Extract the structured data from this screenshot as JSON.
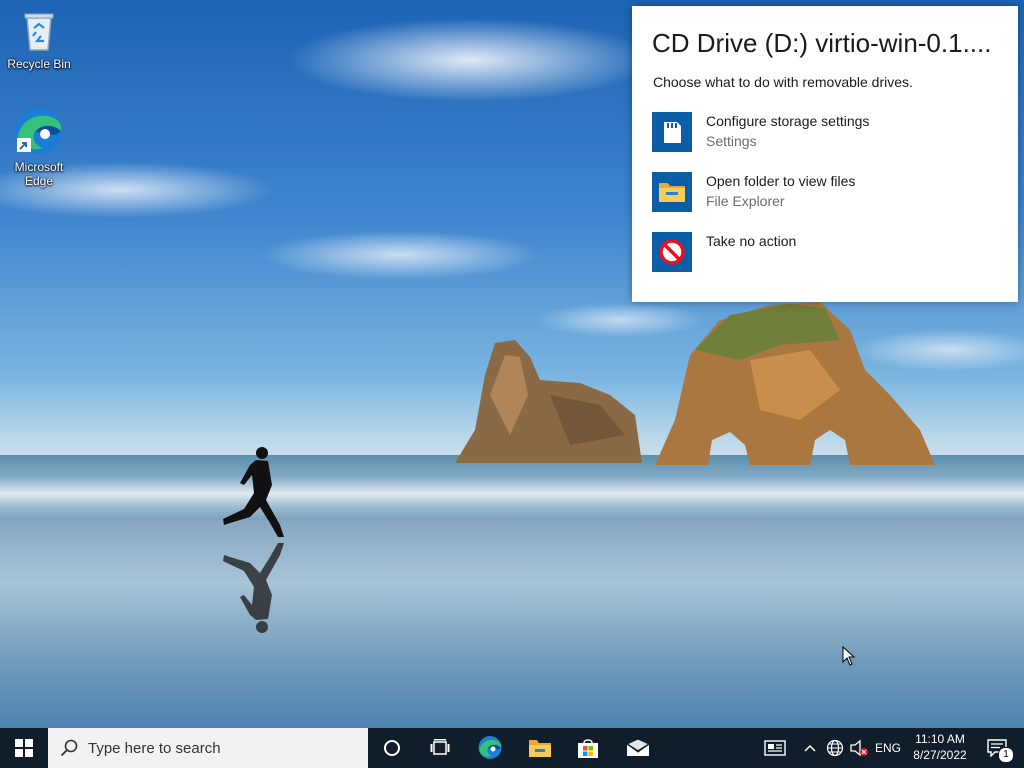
{
  "desktop": {
    "icons": [
      {
        "label": "Recycle Bin",
        "icon": "recycle-bin-icon"
      },
      {
        "label": "Microsoft Edge",
        "icon": "edge-icon"
      }
    ]
  },
  "autoplay": {
    "title": "CD Drive (D:) virtio-win-0.1....",
    "subtitle": "Choose what to do with removable drives.",
    "options": [
      {
        "label": "Configure storage settings",
        "sublabel": "Settings",
        "icon": "storage-card-icon"
      },
      {
        "label": "Open folder to view files",
        "sublabel": "File Explorer",
        "icon": "folder-icon"
      },
      {
        "label": "Take no action",
        "sublabel": "",
        "icon": "no-action-icon"
      }
    ]
  },
  "taskbar": {
    "search_placeholder": "Type here to search",
    "pinned": [
      "start-icon",
      "cortana-icon",
      "task-view-icon",
      "edge-icon",
      "file-explorer-icon",
      "store-icon",
      "mail-icon"
    ],
    "tray": {
      "language": "ENG",
      "time": "11:10 AM",
      "date": "8/27/2022",
      "notification_count": "1"
    }
  },
  "colors": {
    "taskbar_bg": "#101d2b",
    "accent_blue": "#0a5ea8",
    "no_action_red": "#e81123"
  }
}
